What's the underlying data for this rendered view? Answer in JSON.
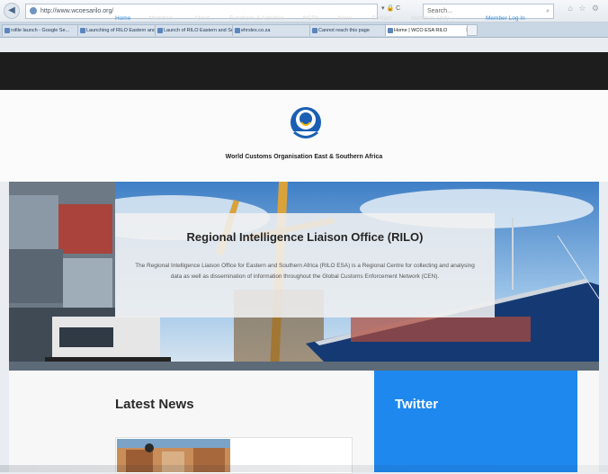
{
  "browser": {
    "url": "http://www.wcoesarilo.org/",
    "url_tools": "▾ 🔒 C",
    "search_placeholder": "Search...",
    "tabs": [
      {
        "label": "rofile launch - Google Se..."
      },
      {
        "label": "Launching of RILO Eastern and..."
      },
      {
        "label": "Launch of RILO Eastern and So..."
      },
      {
        "label": "ehrslex.co.za"
      },
      {
        "label": "Cannot reach this page"
      },
      {
        "label": "Home | WCO ESA RILO",
        "active": true
      }
    ]
  },
  "nav": {
    "items": [
      "Home",
      "Members",
      "About",
      "Functions & Activities",
      "NCP's",
      "News",
      "Contact",
      "Members Only"
    ],
    "login": "Member Log In",
    "accent": "#3b8fe0"
  },
  "header": {
    "org_name": "World Customs Organisation East & Southern Africa"
  },
  "hero": {
    "title": "Regional Intelligence Liaison Office  (RILO)",
    "text": "The Regional Intelligence Liaison Office for Eastern and Southern Africa (RILO ESA) is a Regional Centre for collecting and analysing data as well as dissemination of information throughout the Global Customs Enforcement Network (CEN)."
  },
  "sections": {
    "news_title": "Latest News",
    "twitter_title": "Twitter",
    "twitter_color": "#1e88ee"
  }
}
